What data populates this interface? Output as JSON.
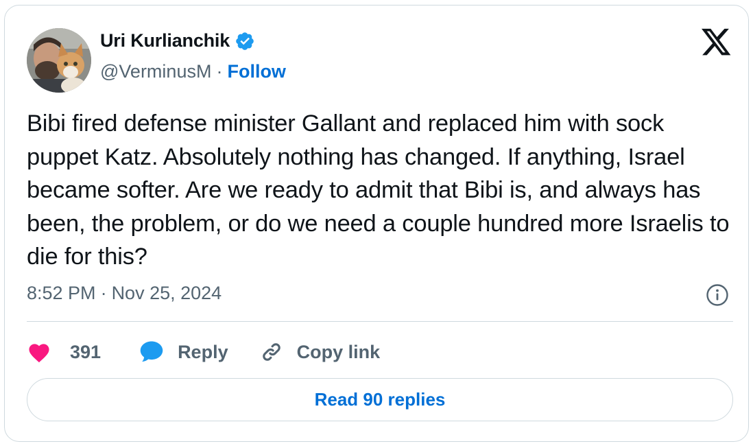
{
  "author": {
    "name": "Uri Kurlianchik",
    "handle": "@VerminusM",
    "follow_label": "Follow",
    "separator": "·"
  },
  "tweet": {
    "text": "Bibi fired defense minister Gallant and replaced him with sock puppet Katz. Absolutely nothing has changed. If anything, Israel became softer. Are we ready to admit that Bibi is, and always has been, the problem, or do we need a couple hundred more Israelis to die for this?",
    "time": "8:52 PM",
    "date": "Nov 25, 2024",
    "separator": "·"
  },
  "actions": {
    "like_count": "391",
    "reply_label": "Reply",
    "copy_label": "Copy link"
  },
  "read_replies_label": "Read 90 replies",
  "icons": [
    "avatar-photo",
    "verified-badge-icon",
    "x-logo-icon",
    "info-icon",
    "heart-icon",
    "reply-bubble-icon",
    "link-icon"
  ],
  "colors": {
    "accent": "#006fd6",
    "verified": "#1d9bf0",
    "heart": "#f91880",
    "reply_bubble": "#1d9bf0",
    "muted": "#536471",
    "border": "#cfd9de"
  }
}
